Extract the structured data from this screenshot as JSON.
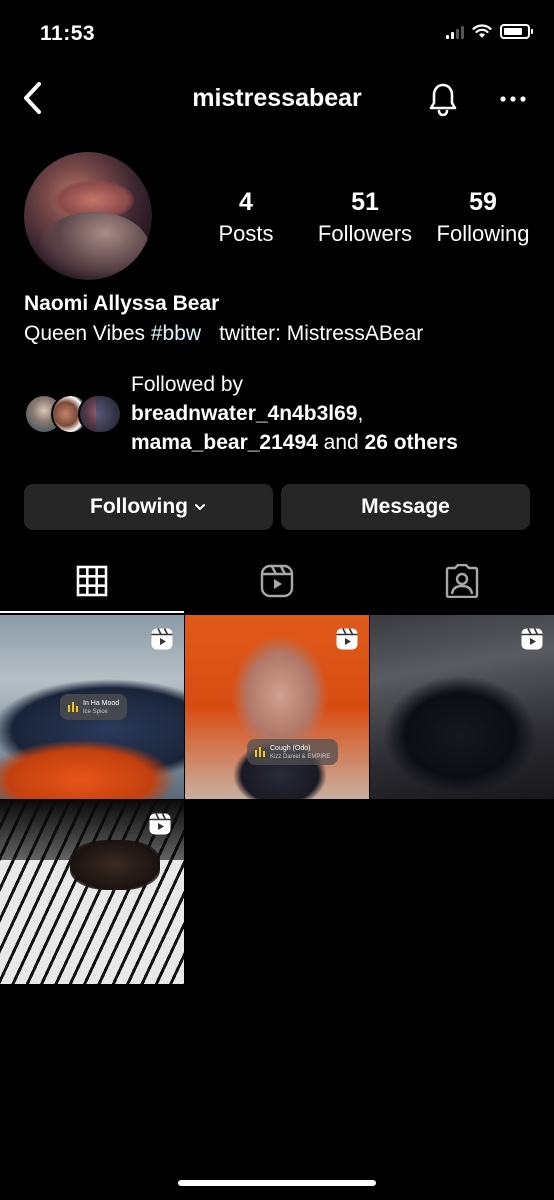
{
  "status_bar": {
    "time": "11:53"
  },
  "header": {
    "username": "mistressabear"
  },
  "profile": {
    "stats": [
      {
        "value": "4",
        "label": "Posts"
      },
      {
        "value": "51",
        "label": "Followers"
      },
      {
        "value": "59",
        "label": "Following"
      }
    ],
    "full_name": "Naomi Allyssa Bear",
    "bio": {
      "text": "Queen Vibes ",
      "hashtag": "#bbw",
      "twitter": "twitter: MistressABear"
    },
    "followed_by": {
      "line1": "Followed by",
      "user1": "breadnwater_4n4b3l69",
      "sep": ",",
      "user2": "mama_bear_21494",
      "and_text": " and ",
      "others": "26 others"
    }
  },
  "actions": {
    "following_label": "Following",
    "message_label": "Message"
  },
  "tabs": [
    {
      "name": "grid",
      "icon": "grid-icon"
    },
    {
      "name": "reels",
      "icon": "reels-icon"
    },
    {
      "name": "tagged",
      "icon": "tagged-icon"
    }
  ],
  "posts": [
    {
      "type": "reel",
      "audio_title": "In Ha Mood",
      "audio_artist": "Ice Spice"
    },
    {
      "type": "reel",
      "audio_title": "Cough (Odo)",
      "audio_artist": "Kizz Daniel & EMPIRE"
    },
    {
      "type": "reel"
    },
    {
      "type": "reel"
    }
  ]
}
